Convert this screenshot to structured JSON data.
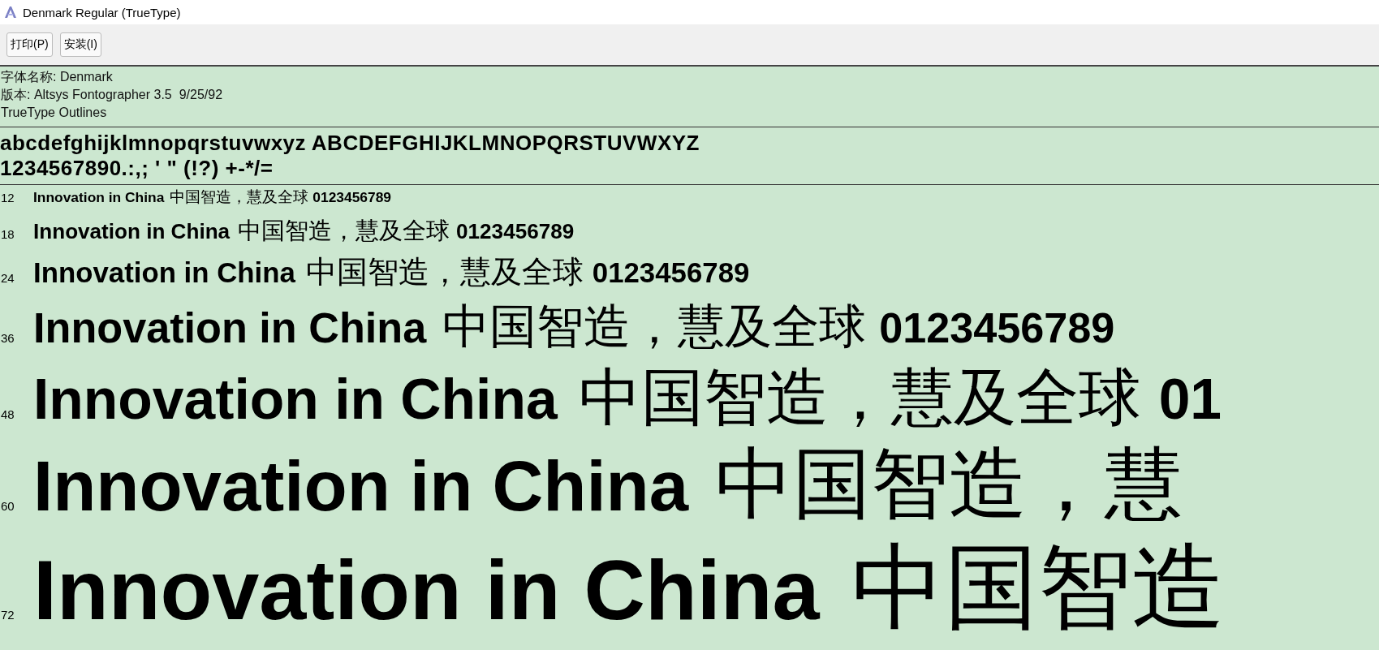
{
  "window": {
    "title": "Denmark Regular (TrueType)"
  },
  "toolbar": {
    "buttons": [
      "打印(P)",
      "安装(I)"
    ]
  },
  "font_info": [
    "字体名称: Denmark",
    "版本: Altsys Fontographer 3.5  9/25/92",
    "TrueType Outlines"
  ],
  "character_set": [
    "abcdefghijklmnopqrstuvwxyz ABCDEFGHIJKLMNOPQRSTUVWXYZ",
    "1234567890.:,; ' \" (!?) +-*/="
  ],
  "samples": [
    {
      "size": "12",
      "latin": "Innovation in China",
      "cjk": "中国智造，慧及全球",
      "digits": "0123456789"
    },
    {
      "size": "18",
      "latin": "Innovation in China",
      "cjk": "中国智造，慧及全球",
      "digits": "0123456789"
    },
    {
      "size": "24",
      "latin": "Innovation in China",
      "cjk": "中国智造，慧及全球",
      "digits": "0123456789"
    },
    {
      "size": "36",
      "latin": "Innovation in China",
      "cjk": "中国智造，慧及全球",
      "digits": "0123456789"
    },
    {
      "size": "48",
      "latin": "Innovation in China",
      "cjk": "中国智造，慧及全球",
      "digits": "01"
    },
    {
      "size": "60",
      "latin": "Innovation in China",
      "cjk": "中国智造，慧"
    },
    {
      "size": "72",
      "latin": "Innovation in China",
      "cjk": "中国智造"
    }
  ]
}
